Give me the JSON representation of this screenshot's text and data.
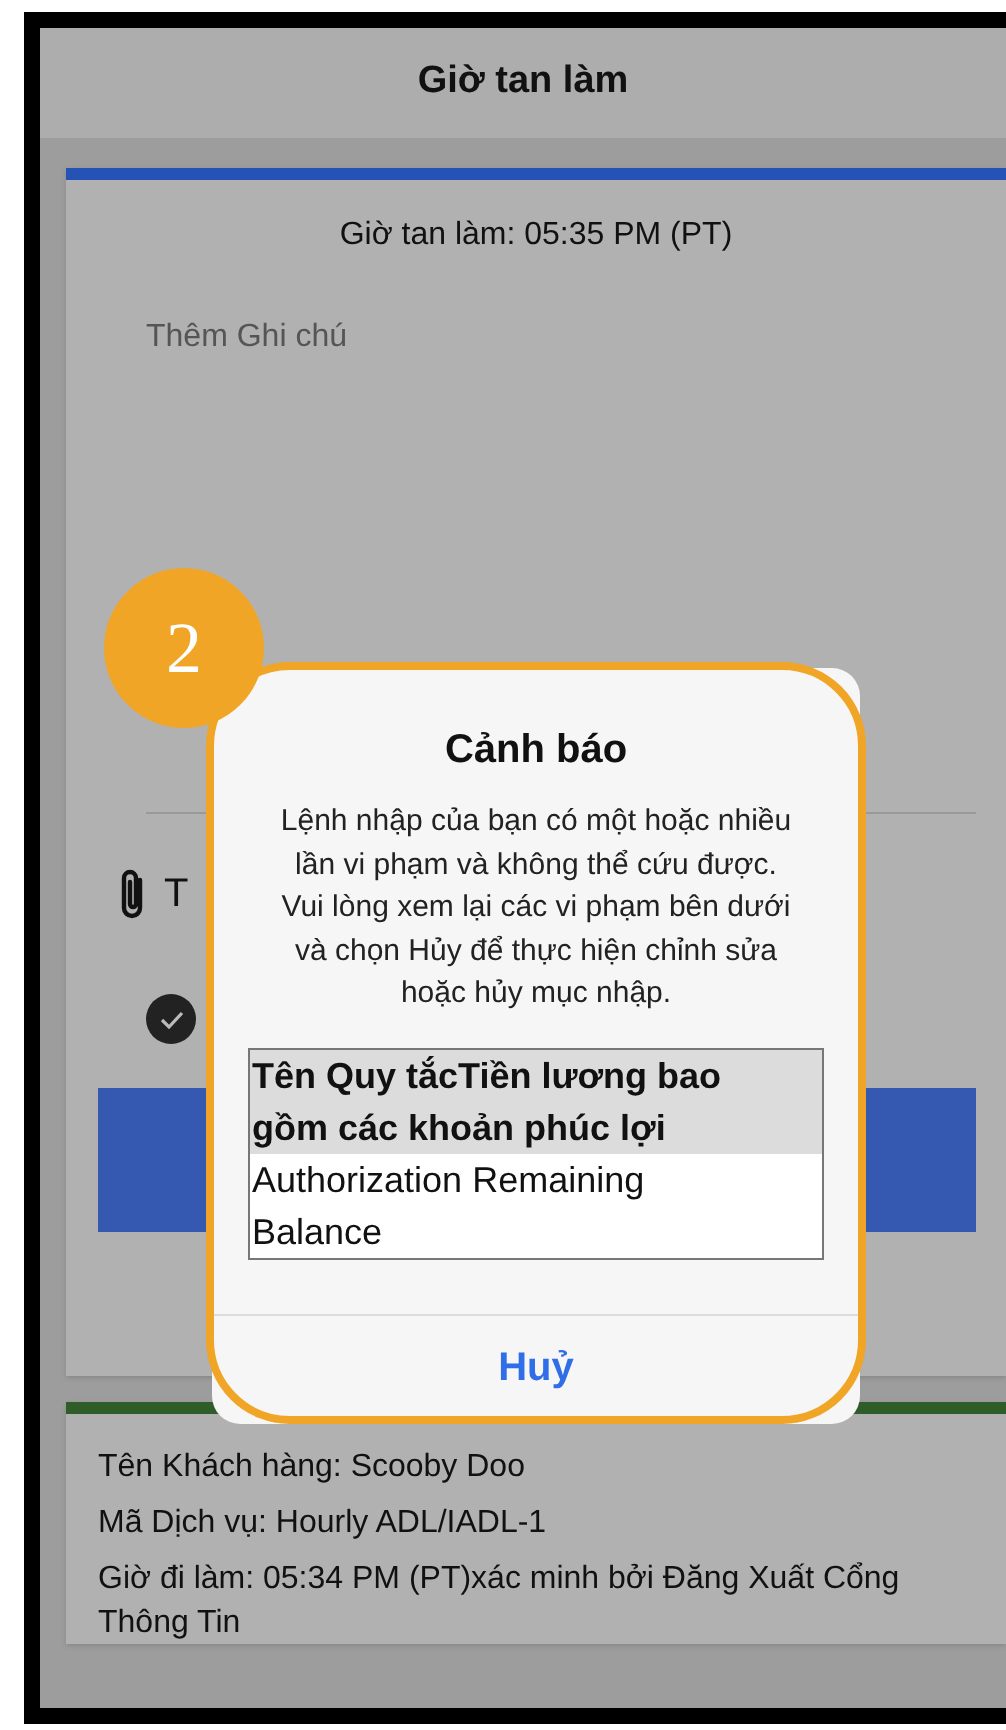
{
  "header": {
    "title": "Giờ tan làm"
  },
  "clock_out_card": {
    "time_label": "Giờ tan làm: 05:35 PM (PT)",
    "note_field": {
      "placeholder": "Thêm Ghi chú"
    },
    "attachment": {
      "label": "T"
    },
    "confirm": {
      "checked": true
    }
  },
  "info_card": {
    "lines": [
      "Tên Khách hàng: Scooby Doo",
      "Mã Dịch vụ: Hourly ADL/IADL-1",
      "Giờ đi làm: 05:34 PM (PT)xác minh bởi Đăng Xuất Cổng Thông Tin"
    ]
  },
  "callout": {
    "number": "2"
  },
  "alert": {
    "title": "Cảnh báo",
    "message": "Lệnh nhập của bạn có một hoặc nhiều lần vi phạm và không thể cứu được. Vui lòng xem lại các vi phạm bên dưới và chọn Hủy để thực hiện chỉnh sửa hoặc hủy mục nhập.",
    "table": {
      "header": "Tên Quy tắcTiền lương bao gồm các khoản phúc lợi",
      "rows": [
        "Authorization Remaining Balance"
      ]
    },
    "buttons": [
      "Huỷ"
    ]
  }
}
